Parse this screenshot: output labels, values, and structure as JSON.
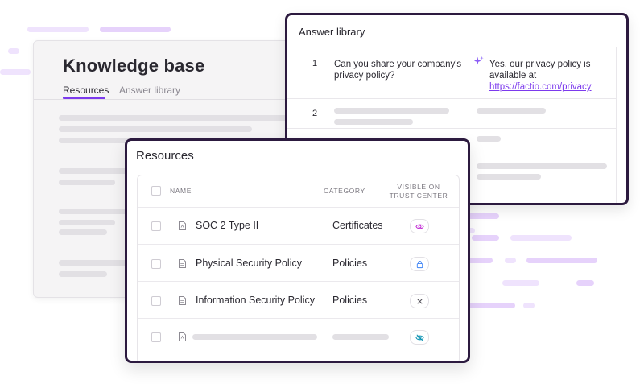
{
  "knowledge_base": {
    "title": "Knowledge base",
    "tabs": [
      {
        "label": "Resources",
        "active": true
      },
      {
        "label": "Answer library",
        "active": false
      }
    ]
  },
  "answer_library": {
    "title": "Answer library",
    "rows": [
      {
        "number": "1",
        "question": "Can you share your company's privacy policy?",
        "answer_prefix": "Yes, our privacy policy is available at ",
        "answer_link": "https://factio.com/privacy",
        "icon": "sparkle-icon"
      },
      {
        "number": "2"
      }
    ]
  },
  "resources": {
    "title": "Resources",
    "columns": {
      "name": "NAME",
      "category": "CATEGORY",
      "visible": "VISIBLE ON TRUST CENTER"
    },
    "rows": [
      {
        "name": "SOC 2 Type II",
        "category": "Certificates",
        "file_icon": "pdf-file-icon",
        "visibility_icon": "eye-icon"
      },
      {
        "name": "Physical Security Policy",
        "category": "Policies",
        "file_icon": "document-icon",
        "visibility_icon": "lock-icon"
      },
      {
        "name": "Information Security Policy",
        "category": "Policies",
        "file_icon": "document-icon",
        "visibility_icon": "x-icon"
      },
      {
        "name": "",
        "category": "",
        "file_icon": "pdf-file-icon",
        "visibility_icon": "eye-off-icon"
      }
    ]
  },
  "colors": {
    "accent": "#7c3aed",
    "frame": "#2c1a3f",
    "streak": "#e6d2fb"
  }
}
